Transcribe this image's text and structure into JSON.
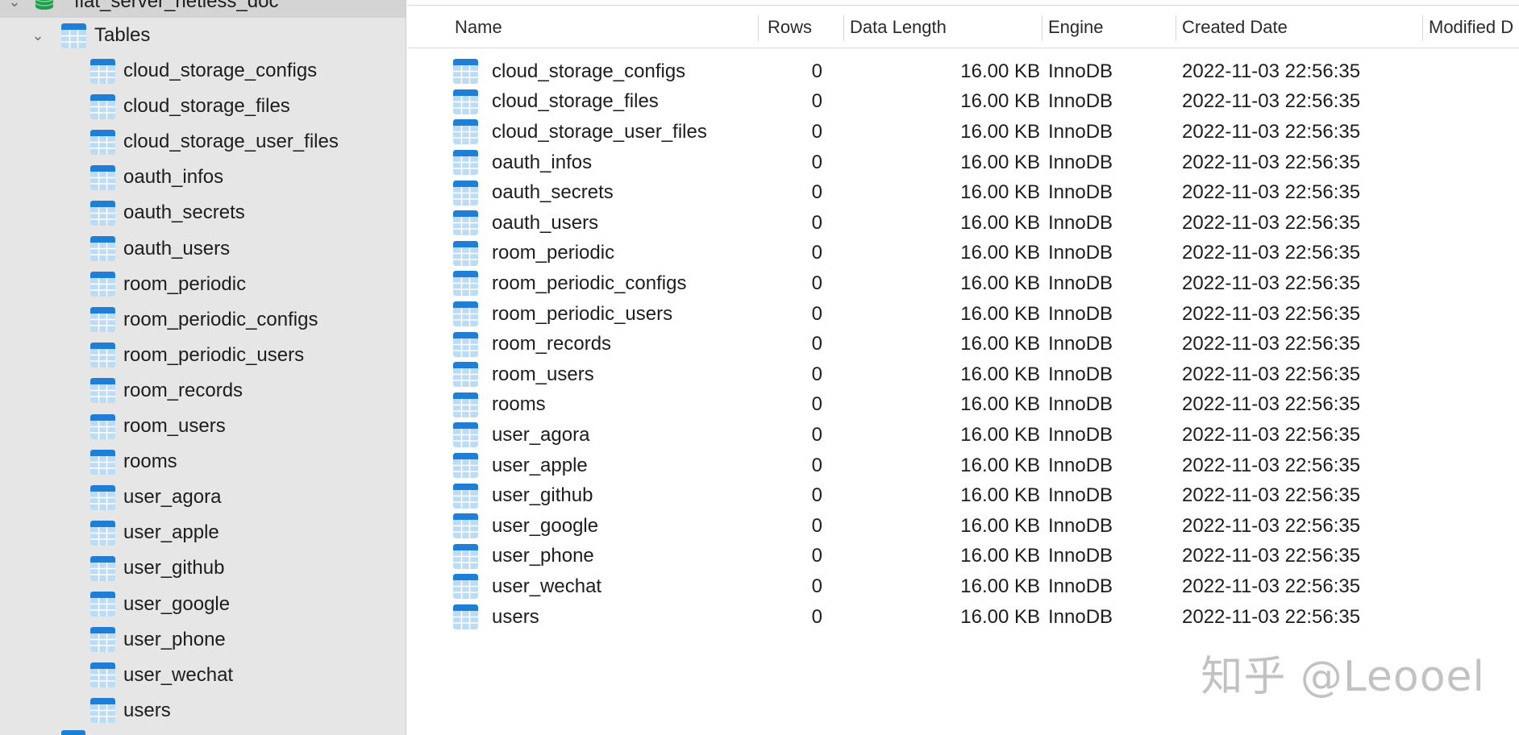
{
  "sidebar": {
    "database_name": "flat_server_netless_doc",
    "group_label": "Tables",
    "tables": [
      "cloud_storage_configs",
      "cloud_storage_files",
      "cloud_storage_user_files",
      "oauth_infos",
      "oauth_secrets",
      "oauth_users",
      "room_periodic",
      "room_periodic_configs",
      "room_periodic_users",
      "room_records",
      "room_users",
      "rooms",
      "user_agora",
      "user_apple",
      "user_github",
      "user_google",
      "user_phone",
      "user_wechat",
      "users"
    ],
    "icons": {
      "database": "database-icon",
      "table": "table-icon",
      "chevron": "chevron-down-icon"
    }
  },
  "columns": {
    "name": "Name",
    "rows": "Rows",
    "data_length": "Data Length",
    "engine": "Engine",
    "created": "Created Date",
    "modified": "Modified D"
  },
  "table_rows": [
    {
      "name": "cloud_storage_configs",
      "rows": "0",
      "data_length": "16.00 KB",
      "engine": "InnoDB",
      "created": "2022-11-03 22:56:35"
    },
    {
      "name": "cloud_storage_files",
      "rows": "0",
      "data_length": "16.00 KB",
      "engine": "InnoDB",
      "created": "2022-11-03 22:56:35"
    },
    {
      "name": "cloud_storage_user_files",
      "rows": "0",
      "data_length": "16.00 KB",
      "engine": "InnoDB",
      "created": "2022-11-03 22:56:35"
    },
    {
      "name": "oauth_infos",
      "rows": "0",
      "data_length": "16.00 KB",
      "engine": "InnoDB",
      "created": "2022-11-03 22:56:35"
    },
    {
      "name": "oauth_secrets",
      "rows": "0",
      "data_length": "16.00 KB",
      "engine": "InnoDB",
      "created": "2022-11-03 22:56:35"
    },
    {
      "name": "oauth_users",
      "rows": "0",
      "data_length": "16.00 KB",
      "engine": "InnoDB",
      "created": "2022-11-03 22:56:35"
    },
    {
      "name": "room_periodic",
      "rows": "0",
      "data_length": "16.00 KB",
      "engine": "InnoDB",
      "created": "2022-11-03 22:56:35"
    },
    {
      "name": "room_periodic_configs",
      "rows": "0",
      "data_length": "16.00 KB",
      "engine": "InnoDB",
      "created": "2022-11-03 22:56:35"
    },
    {
      "name": "room_periodic_users",
      "rows": "0",
      "data_length": "16.00 KB",
      "engine": "InnoDB",
      "created": "2022-11-03 22:56:35"
    },
    {
      "name": "room_records",
      "rows": "0",
      "data_length": "16.00 KB",
      "engine": "InnoDB",
      "created": "2022-11-03 22:56:35"
    },
    {
      "name": "room_users",
      "rows": "0",
      "data_length": "16.00 KB",
      "engine": "InnoDB",
      "created": "2022-11-03 22:56:35"
    },
    {
      "name": "rooms",
      "rows": "0",
      "data_length": "16.00 KB",
      "engine": "InnoDB",
      "created": "2022-11-03 22:56:35"
    },
    {
      "name": "user_agora",
      "rows": "0",
      "data_length": "16.00 KB",
      "engine": "InnoDB",
      "created": "2022-11-03 22:56:35"
    },
    {
      "name": "user_apple",
      "rows": "0",
      "data_length": "16.00 KB",
      "engine": "InnoDB",
      "created": "2022-11-03 22:56:35"
    },
    {
      "name": "user_github",
      "rows": "0",
      "data_length": "16.00 KB",
      "engine": "InnoDB",
      "created": "2022-11-03 22:56:35"
    },
    {
      "name": "user_google",
      "rows": "0",
      "data_length": "16.00 KB",
      "engine": "InnoDB",
      "created": "2022-11-03 22:56:35"
    },
    {
      "name": "user_phone",
      "rows": "0",
      "data_length": "16.00 KB",
      "engine": "InnoDB",
      "created": "2022-11-03 22:56:35"
    },
    {
      "name": "user_wechat",
      "rows": "0",
      "data_length": "16.00 KB",
      "engine": "InnoDB",
      "created": "2022-11-03 22:56:35"
    },
    {
      "name": "users",
      "rows": "0",
      "data_length": "16.00 KB",
      "engine": "InnoDB",
      "created": "2022-11-03 22:56:35"
    }
  ],
  "watermark": "知乎 @Leooel",
  "colors": {
    "sidebar_bg": "#e6e6e6",
    "selected_bg": "#d4d4d4",
    "table_icon_blue": "#1f7fd6",
    "table_icon_light": "#bcdcf6",
    "db_icon_green": "#1e9e4a"
  }
}
